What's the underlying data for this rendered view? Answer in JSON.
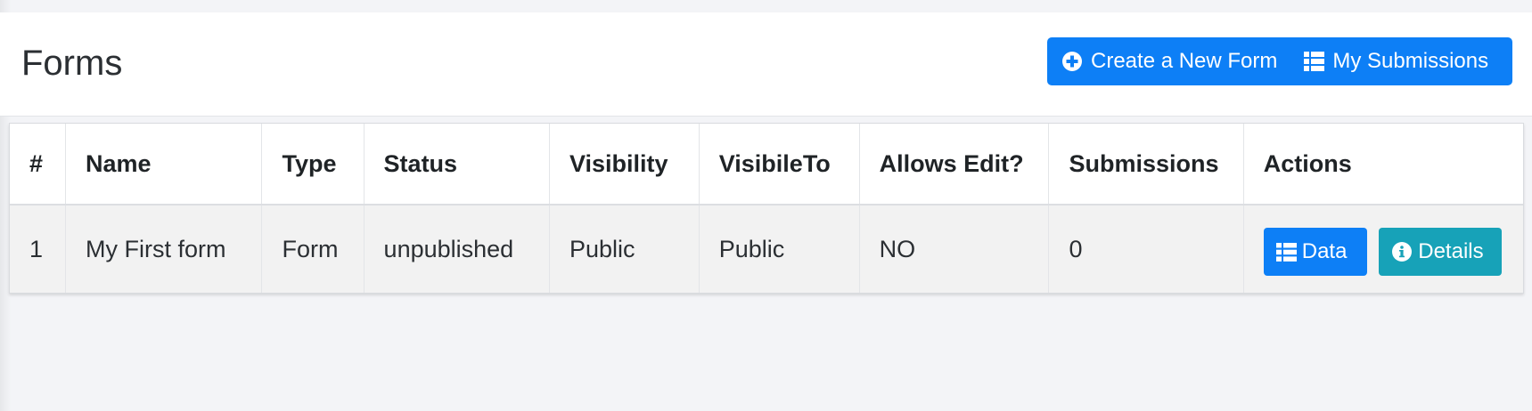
{
  "page": {
    "title": "Forms"
  },
  "header_actions": {
    "create_label": "Create a New Form",
    "submissions_label": "My Submissions",
    "accent_color": "#0d7ff6"
  },
  "table": {
    "columns": [
      "#",
      "Name",
      "Type",
      "Status",
      "Visibility",
      "VisibileTo",
      "Allows Edit?",
      "Submissions",
      "Actions"
    ],
    "rows": [
      {
        "index": "1",
        "name": "My First form",
        "type": "Form",
        "status": "unpublished",
        "visibility": "Public",
        "visible_to": "Public",
        "allows_edit": "NO",
        "submissions": "0",
        "actions": {
          "data_label": "Data",
          "details_label": "Details"
        }
      }
    ]
  },
  "icons": {
    "create": "plus-circle-icon",
    "submissions": "list-icon",
    "data": "list-icon",
    "details": "info-circle-icon"
  },
  "colors": {
    "primary": "#0d7ff6",
    "info": "#17a2b8",
    "row_background": "#f2f2f2"
  }
}
